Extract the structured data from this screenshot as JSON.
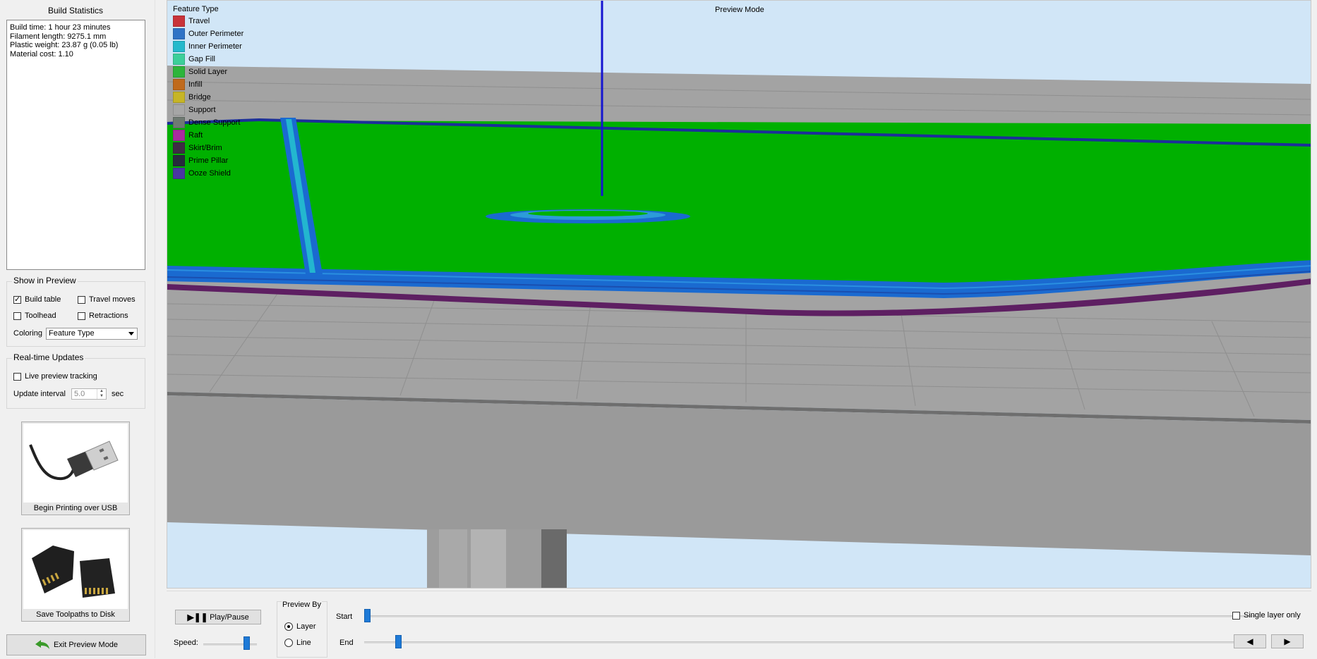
{
  "sidebar": {
    "stats_title": "Build Statistics",
    "stats": [
      "Build time: 1 hour 23 minutes",
      "Filament length: 9275.1 mm",
      "Plastic weight: 23.87 g (0.05 lb)",
      "Material cost: 1.10"
    ],
    "show_in_preview": {
      "title": "Show in Preview",
      "build_table": {
        "label": "Build table",
        "checked": true
      },
      "travel_moves": {
        "label": "Travel moves",
        "checked": false
      },
      "toolhead": {
        "label": "Toolhead",
        "checked": false
      },
      "retractions": {
        "label": "Retractions",
        "checked": false
      },
      "coloring_label": "Coloring",
      "coloring_value": "Feature Type"
    },
    "realtime": {
      "title": "Real-time Updates",
      "live_tracking": {
        "label": "Live preview tracking",
        "checked": false
      },
      "interval_label": "Update interval",
      "interval_value": "5.0",
      "interval_unit": "sec"
    },
    "usb_button": "Begin Printing over USB",
    "sd_button": "Save Toolpaths to Disk",
    "exit_button": "Exit Preview Mode"
  },
  "viewport": {
    "mode_label": "Preview Mode",
    "legend_title": "Feature Type",
    "legend": [
      {
        "label": "Travel",
        "color": "#c8333a"
      },
      {
        "label": "Outer Perimeter",
        "color": "#2f73c6"
      },
      {
        "label": "Inner Perimeter",
        "color": "#25b9cc"
      },
      {
        "label": "Gap Fill",
        "color": "#3ccf9a"
      },
      {
        "label": "Solid Layer",
        "color": "#2db53b"
      },
      {
        "label": "Infill",
        "color": "#c06a1c"
      },
      {
        "label": "Bridge",
        "color": "#c6b526"
      },
      {
        "label": "Support",
        "color": "#a6a6a6"
      },
      {
        "label": "Dense Support",
        "color": "#6f7a72"
      },
      {
        "label": "Raft",
        "color": "#a92ba0"
      },
      {
        "label": "Skirt/Brim",
        "color": "#3f2b44"
      },
      {
        "label": "Prime Pillar",
        "color": "#272a3c"
      },
      {
        "label": "Ooze Shield",
        "color": "#4a36a3"
      }
    ]
  },
  "controls": {
    "play_pause": "Play/Pause",
    "speed_label": "Speed:",
    "speed_fraction": 0.85,
    "preview_by_title": "Preview By",
    "preview_by_layer": "Layer",
    "preview_by_line": "Line",
    "start_label": "Start",
    "end_label": "End",
    "start_fraction": 0.0,
    "end_fraction": 0.035,
    "single_layer": "Single layer only"
  }
}
